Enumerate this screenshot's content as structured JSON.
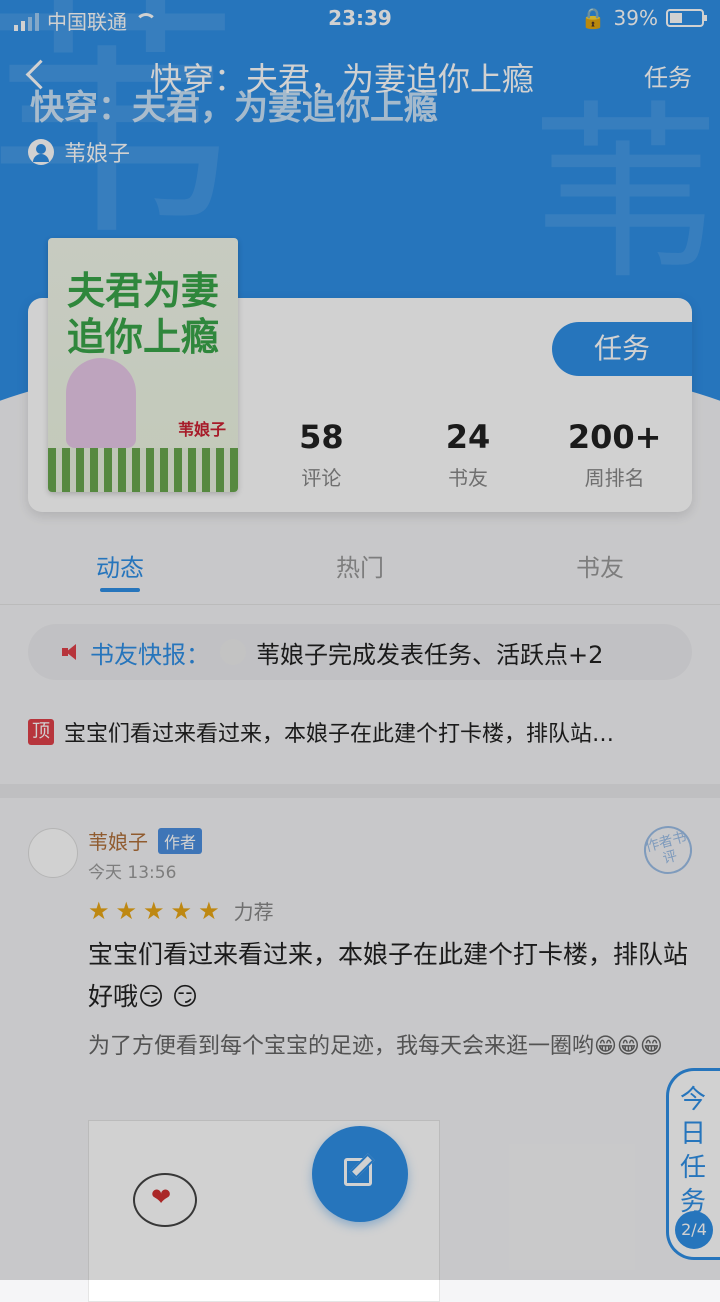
{
  "status_bar": {
    "carrier": "中国联通",
    "time": "23:39",
    "battery": "39%"
  },
  "nav": {
    "title": "快穿：夫君，为妻追你上瘾",
    "task": "任务"
  },
  "hero": {
    "book_title": "快穿：夫君，为妻追你上瘾",
    "author": "苇娘子",
    "watermark": "苇"
  },
  "cover": {
    "title": "夫君为妻追你上瘾",
    "author": "苇娘子"
  },
  "card": {
    "task_button": "任务",
    "stats": [
      {
        "value": "58",
        "label": "评论"
      },
      {
        "value": "24",
        "label": "书友"
      },
      {
        "value": "200+",
        "label": "周排名"
      }
    ]
  },
  "tabs": [
    "动态",
    "热门",
    "书友"
  ],
  "news": {
    "label": "书友快报：",
    "text": "苇娘子完成发表任务、活跃点+2"
  },
  "pinned": {
    "badge": "顶",
    "text": "宝宝们看过来看过来，本娘子在此建个打卡楼，排队站…"
  },
  "post": {
    "author": "苇娘子",
    "author_badge": "作者",
    "time": "今天 13:56",
    "stamp": "作者书评",
    "rating": 5,
    "rating_label": "力荐",
    "headline": "宝宝们看过来看过来，本娘子在此建个打卡楼，排队站好哦😏 😏",
    "body": "为了方便看到每个宝宝的足迹，我每天会来逛一圈哟😁😁😁"
  },
  "daily_task": {
    "label": "今日任务",
    "count": "2/4"
  },
  "colors": {
    "accent": "#2f8fe6",
    "alert": "#e0414a"
  }
}
